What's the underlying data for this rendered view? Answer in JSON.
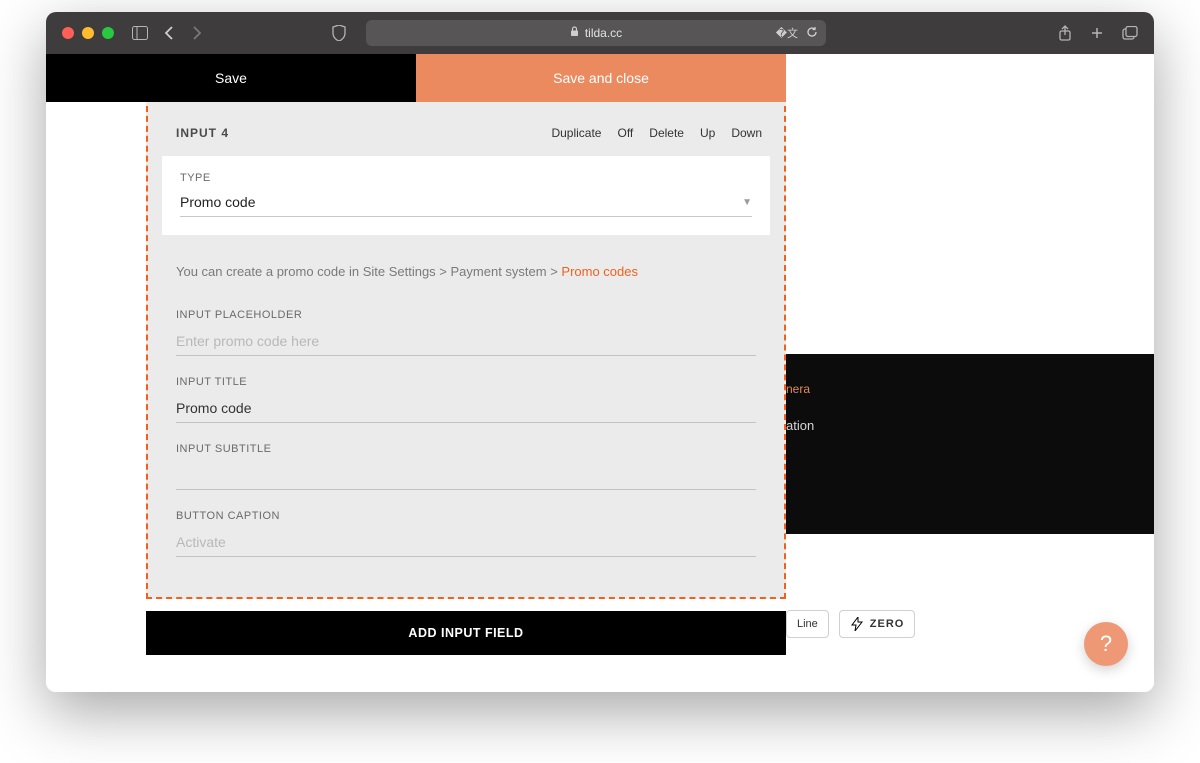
{
  "browser": {
    "address": "tilda.cc"
  },
  "topbar": {
    "save_label": "Save",
    "save_close_label": "Save and close"
  },
  "inputCard": {
    "header_title": "INPUT 4",
    "actions": {
      "duplicate": "Duplicate",
      "off": "Off",
      "delete": "Delete",
      "up": "Up",
      "down": "Down"
    },
    "type_label": "TYPE",
    "type_value": "Promo code",
    "hint_prefix": "You can create a promo code in Site Settings > Payment system > ",
    "hint_link": "Promo codes",
    "fields": {
      "placeholder_label": "INPUT PLACEHOLDER",
      "placeholder_placeholder": "Enter promo code here",
      "title_label": "INPUT TITLE",
      "title_value": "Promo code",
      "subtitle_label": "INPUT SUBTITLE",
      "subtitle_value": "",
      "button_caption_label": "BUTTON CAPTION",
      "button_caption_placeholder": "Activate"
    }
  },
  "add_field_label": "ADD INPUT FIELD",
  "preview": {
    "line1": "nera",
    "line2": "ation",
    "badge_line": "Line",
    "badge_zero": "ZERO"
  },
  "help_label": "?"
}
